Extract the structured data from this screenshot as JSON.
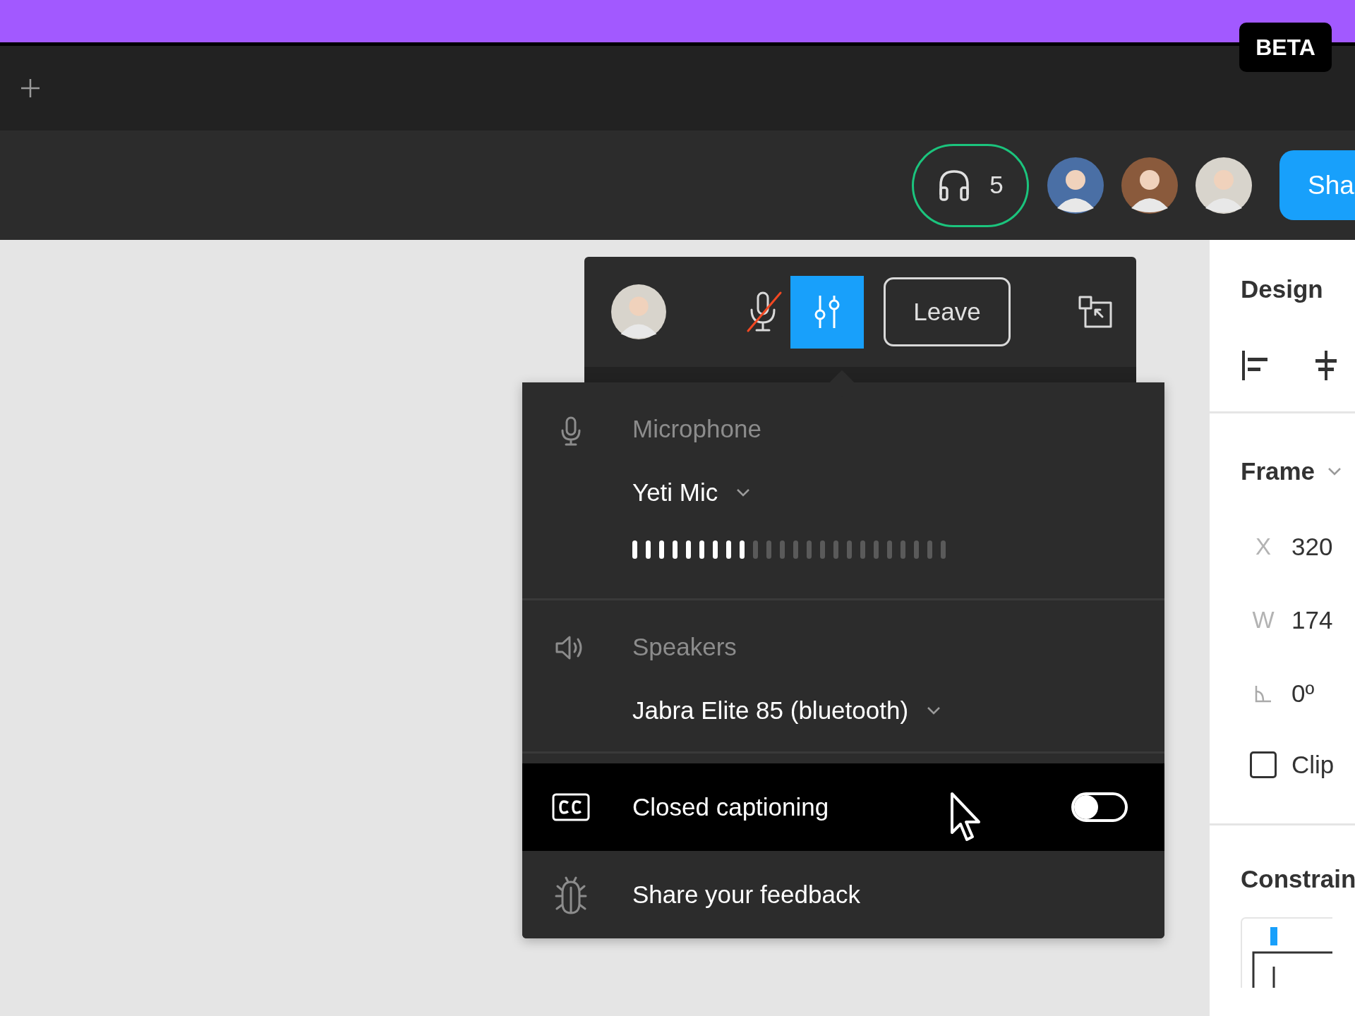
{
  "banner": {
    "badge": "BETA"
  },
  "toolbar": {
    "listeners": {
      "count": "5"
    },
    "avatars": [
      {
        "color": "#4a6fa5"
      },
      {
        "color": "#8a5a3c"
      },
      {
        "color": "#d8d4cc"
      }
    ],
    "share_button": "Sha"
  },
  "call_bar": {
    "mic_muted": true,
    "settings_selected": true,
    "leave_button": "Leave"
  },
  "audio_menu": {
    "sections": [
      {
        "kind": "microphone",
        "label": "Microphone",
        "device": "Yeti Mic",
        "level": 0.375
      },
      {
        "kind": "speakers",
        "label": "Speakers",
        "device": "Jabra Elite 85 (bluetooth)"
      }
    ],
    "items": [
      {
        "kind": "toggle",
        "label": "Closed captioning",
        "on": false,
        "hovered": true
      },
      {
        "kind": "feedback",
        "label": "Share your feedback",
        "hovered": false
      }
    ]
  },
  "design_panel": {
    "title": "Design",
    "frame": {
      "label": "Frame",
      "fields": [
        {
          "kind": "x",
          "label": "X",
          "value": "320"
        },
        {
          "kind": "w",
          "label": "W",
          "value": "174"
        },
        {
          "kind": "rotation",
          "value": "0º"
        }
      ],
      "clip": {
        "label": "Clip",
        "checked": false
      }
    },
    "constraints": {
      "title": "Constrain"
    }
  }
}
